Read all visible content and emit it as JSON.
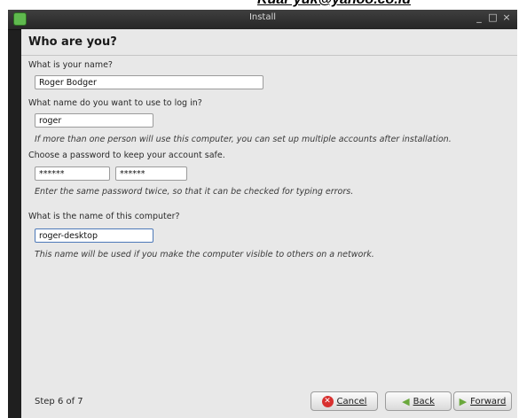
{
  "watermark": "Kuar yuk@yanoo.co.id",
  "window": {
    "title": "Install",
    "controls": [
      "_",
      "□",
      "×"
    ]
  },
  "page": {
    "heading": "Who are you?",
    "name_label": "What is your name?",
    "name_value": "Roger Bodger",
    "login_label": "What name do you want to use to log in?",
    "login_value": "roger",
    "login_hint": "If more than one person will use this computer, you can set up multiple accounts after installation.",
    "password_label": "Choose a password to keep your account safe.",
    "password_value": "******",
    "password_confirm_value": "******",
    "password_hint": "Enter the same password twice, so that it can be checked for typing errors.",
    "computer_label": "What is the name of this computer?",
    "computer_value": "roger-desktop",
    "computer_hint": "This name will be used if you make the computer visible to others on a network."
  },
  "footer": {
    "step": "Step 6 of 7",
    "cancel": "Cancel",
    "back": "Back",
    "forward": "Forward"
  },
  "icons": {
    "cancel": "red-circle-x",
    "back": "green-left-arrow",
    "forward": "green-right-arrow"
  },
  "colors": {
    "cancel_icon": "#d8302f",
    "arrow_icon": "#6aa83c",
    "active_field_border": "#4c78b8"
  }
}
